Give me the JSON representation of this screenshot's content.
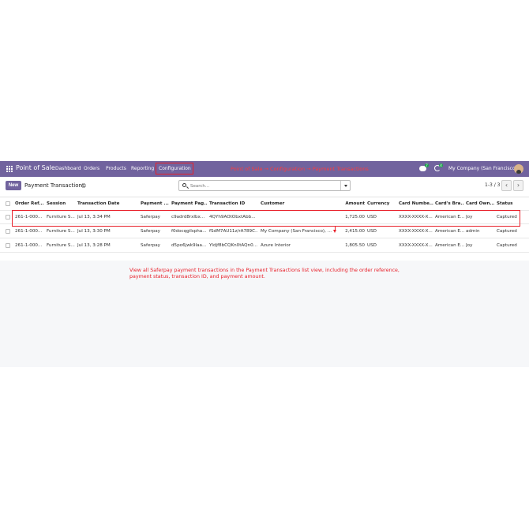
{
  "navbar": {
    "app_name": "Point of Sale",
    "menu": [
      "Dashboard",
      "Orders",
      "Products",
      "Reporting",
      "Configuration"
    ],
    "annotation": "Point of Sale → Configuration → Payment Transactions",
    "chat_badge": "7",
    "activity_badge": "4",
    "company": "My Company (San Francisco)",
    "color": "#71639e"
  },
  "control": {
    "new_label": "New",
    "breadcrumb": "Payment Transactions",
    "search_placeholder": "Search...",
    "pager": "1-3 / 3",
    "prev": "‹",
    "next": "›"
  },
  "table": {
    "columns": [
      "Order Ref...",
      "Session",
      "Transaction Date",
      "Payment ...",
      "Payment Pag...",
      "Transaction ID",
      "Customer",
      "Amount",
      "Currency",
      "Card Numbe...",
      "Card's Bra...",
      "Card Own...",
      "Status"
    ],
    "rows": [
      [
        "261-1-000...",
        "Furniture S...",
        "Jul 13, 3:34 PM",
        "Saferpay",
        "c9adrd8rxlbx...",
        "4QYh9AOtObxtAbb...",
        "",
        "1,725.00",
        "USD",
        "XXXX-XXXX-X...",
        "American E...",
        "Joy",
        "Captured"
      ],
      [
        "261-1-000...",
        "Furniture S...",
        "Jul 13, 3:30 PM",
        "Saferpay",
        "f0docqgilsphа...",
        "fSdM7AU11z/rA789C...",
        "My Company (San Francisco), ...",
        "2,415.00",
        "USD",
        "XXXX-XXXX-X...",
        "American E...",
        "admin",
        "Captured"
      ],
      [
        "261-1-000...",
        "Furniture S...",
        "Jul 13, 3:28 PM",
        "Saferpay",
        "d5po6jwk9laa...",
        "Yldjf8bCQKn0tAQn0...",
        "Azure Interior",
        "1,805.50",
        "USD",
        "XXXX-XXXX-X...",
        "American E...",
        "Joy",
        "Captured"
      ]
    ]
  },
  "caption": "View all Saferpay payment transactions in the Payment Transactions list view, including the order reference, payment status, transaction ID, and payment amount.",
  "highlight_color": "#e8202a"
}
